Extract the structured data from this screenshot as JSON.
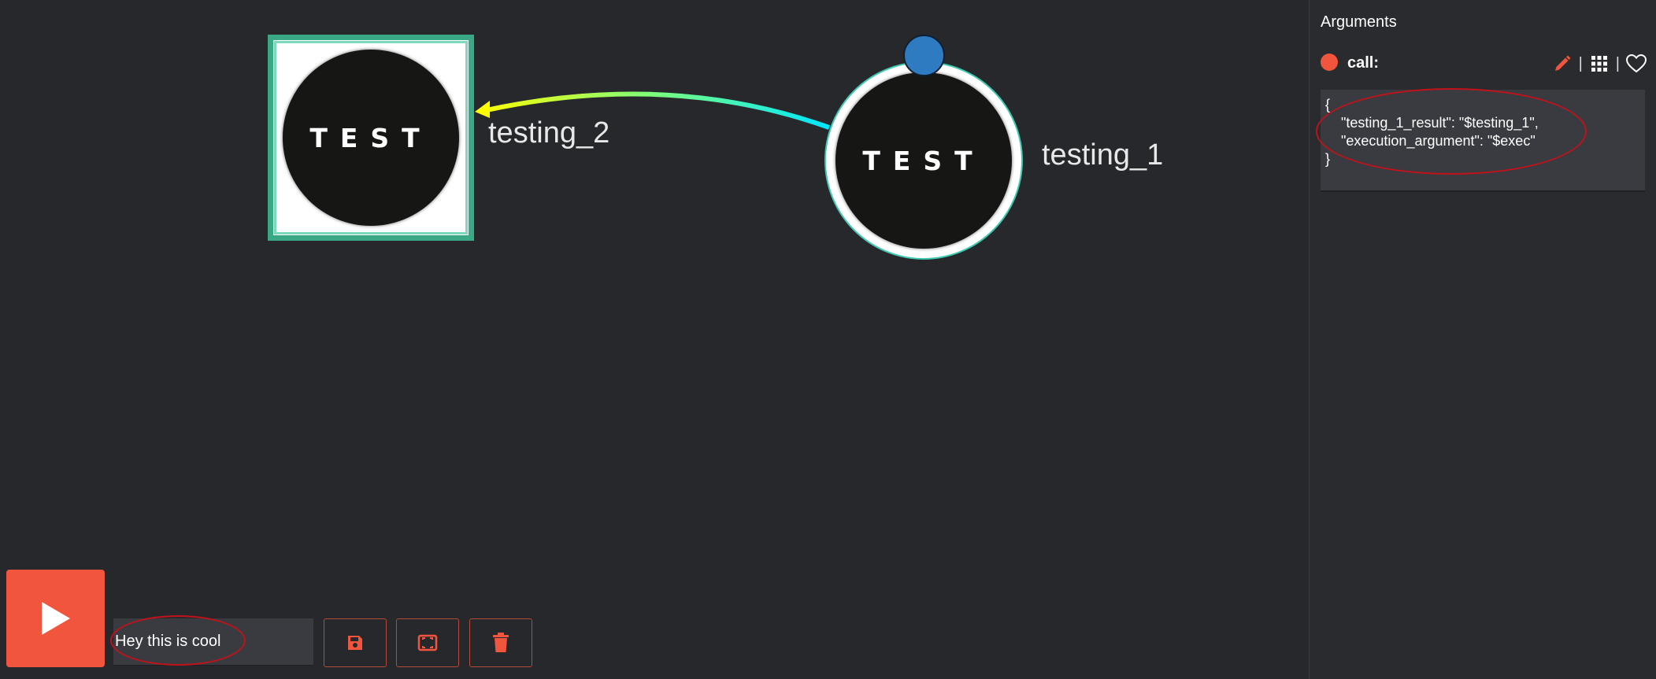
{
  "graph": {
    "nodes": [
      {
        "label": "testing_2",
        "logo_text": "TEST",
        "shape": "square"
      },
      {
        "label": "testing_1",
        "logo_text": "TEST",
        "shape": "circle"
      }
    ],
    "edge": {
      "from": "testing_1",
      "to": "testing_2",
      "colors": [
        "#ffff00",
        "#7cff7c",
        "#00e5ff"
      ]
    }
  },
  "panel": {
    "title": "Arguments",
    "call_label": "call:",
    "code_lines": [
      "{",
      "    \"testing_1_result\": \"$testing_1\",",
      "    \"execution_argument\": \"$exec\"",
      "}"
    ],
    "icons": [
      "pencil-icon",
      "grid-icon",
      "heart-icon"
    ]
  },
  "toolbar": {
    "workflow_name": "Hey this is cool",
    "icons": [
      "play-icon",
      "save-icon",
      "fullscreen-icon",
      "trash-icon"
    ]
  },
  "colors": {
    "accent": "#f2553d",
    "node_border": "#3aa884",
    "start_dot": "#2f7bc2",
    "background": "#27282c",
    "annotation": "#c0121a"
  }
}
